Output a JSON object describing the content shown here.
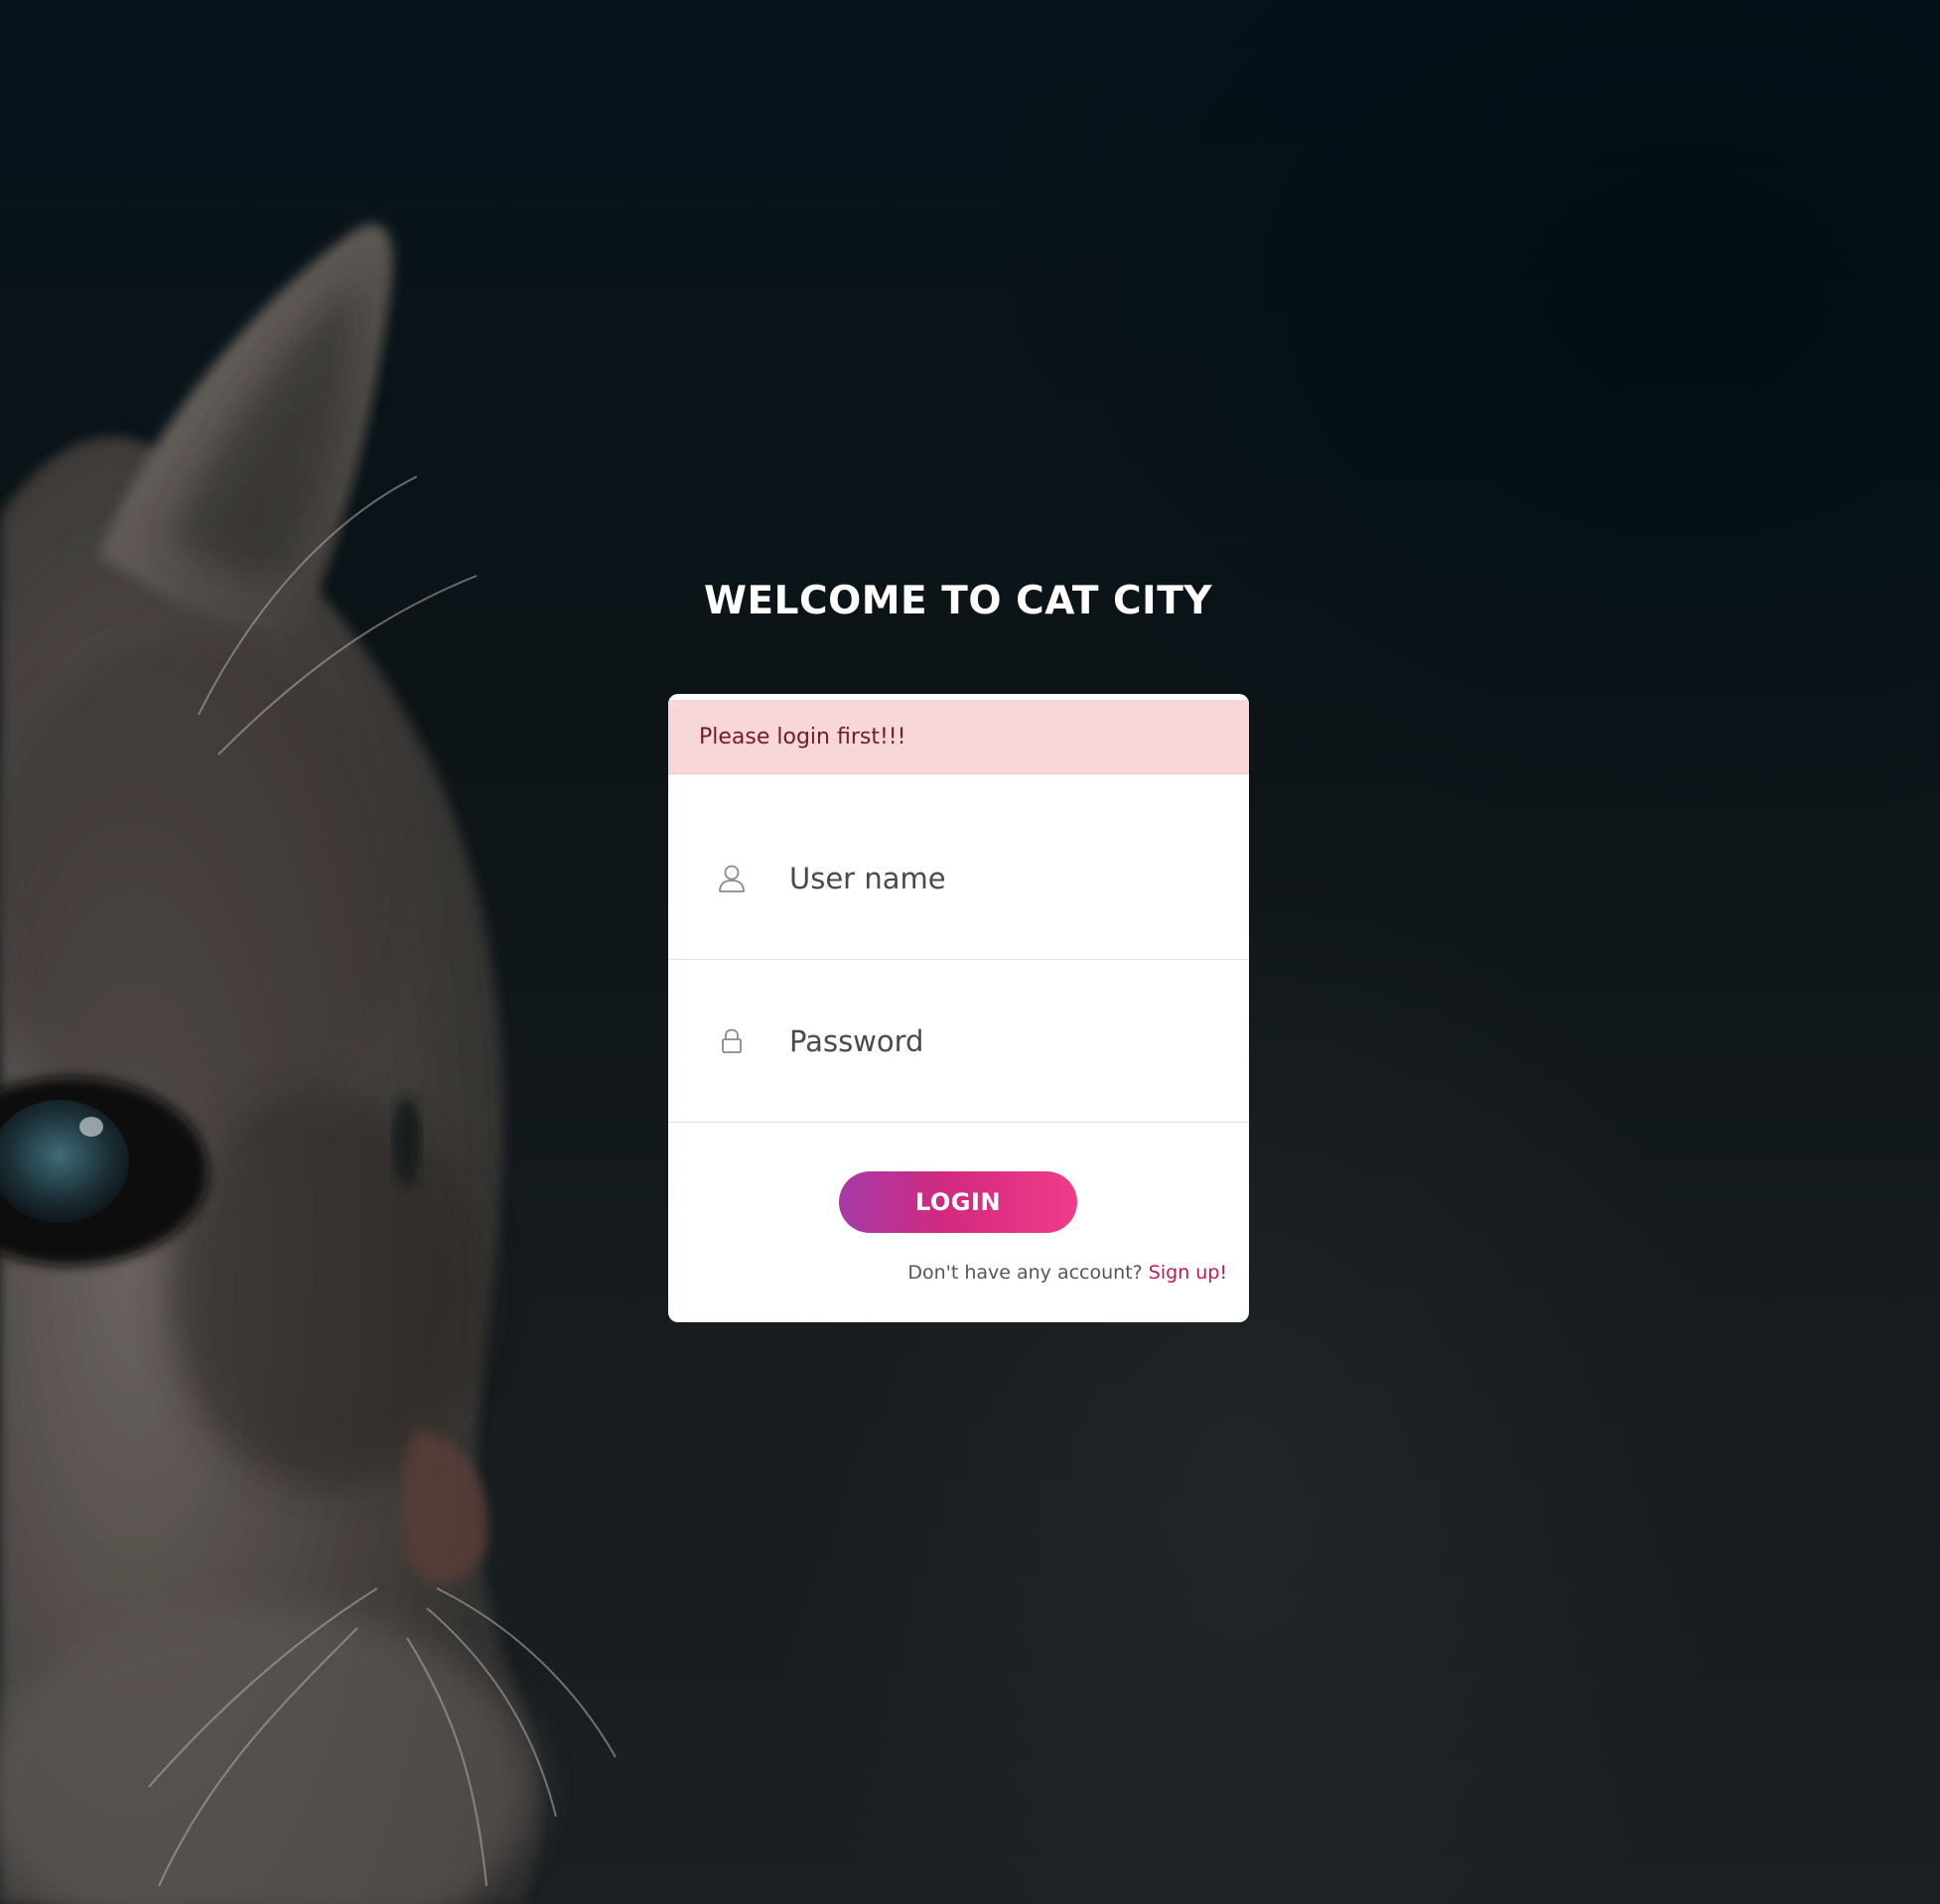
{
  "page": {
    "title": "WELCOME TO CAT CITY"
  },
  "alert": {
    "message": "Please login first!!!"
  },
  "form": {
    "username_placeholder": "User name",
    "password_placeholder": "Password",
    "login_label": "LOGIN",
    "signup_prompt": "Don't have any account?",
    "signup_link": "Sign up!"
  },
  "icons": {
    "username": "user-icon",
    "password": "lock-icon"
  },
  "colors": {
    "button_gradient_start": "#a63aa8",
    "button_gradient_end": "#f23b8a",
    "signup_link": "#c2185b",
    "alert_background": "#f8d7da",
    "alert_text": "#721c24"
  }
}
